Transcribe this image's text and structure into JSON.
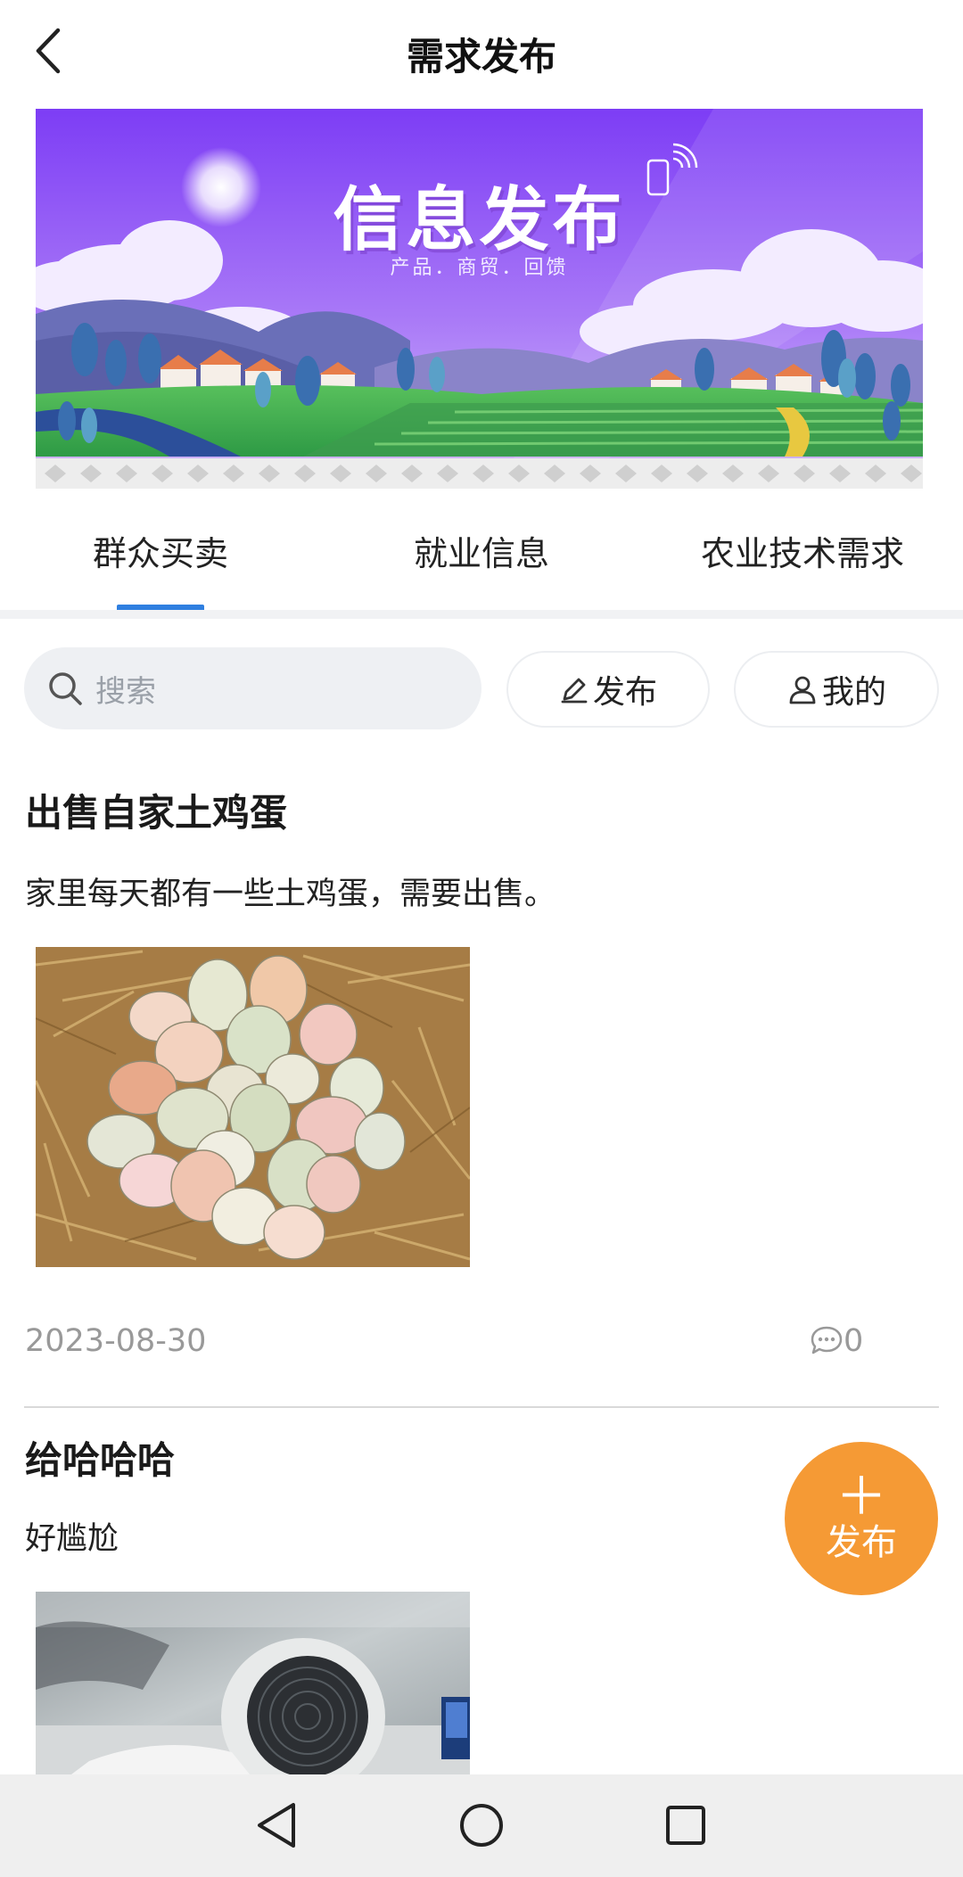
{
  "header": {
    "title": "需求发布",
    "back_icon": "chevron-left-icon"
  },
  "banner": {
    "title": "信息发布",
    "subtitle": "产品．商贸．回馈",
    "colors": {
      "sky_top": "#8a4dff",
      "sky_bottom": "#c8a8ff",
      "field": "#3fae4a"
    }
  },
  "tabs": [
    {
      "label": "群众买卖",
      "active": true
    },
    {
      "label": "就业信息",
      "active": false
    },
    {
      "label": "农业技术需求",
      "active": false
    }
  ],
  "accent_color": "#2f7fe0",
  "toolbar": {
    "search_placeholder": "搜索",
    "publish_label": "发布",
    "mine_label": "我的"
  },
  "posts": [
    {
      "title": "出售自家土鸡蛋",
      "description": "家里每天都有一些土鸡蛋，需要出售。",
      "image": "eggs-in-straw-nest",
      "date": "2023-08-30",
      "comments": "0"
    },
    {
      "title": "给哈哈哈",
      "description": "好尴尬",
      "image": "desk-fan-photo"
    }
  ],
  "fab": {
    "icon": "plus-icon",
    "label": "发布",
    "color": "#f59a35"
  },
  "navbar": {
    "back": "triangle-back-icon",
    "home": "circle-home-icon",
    "recents": "square-recents-icon"
  }
}
